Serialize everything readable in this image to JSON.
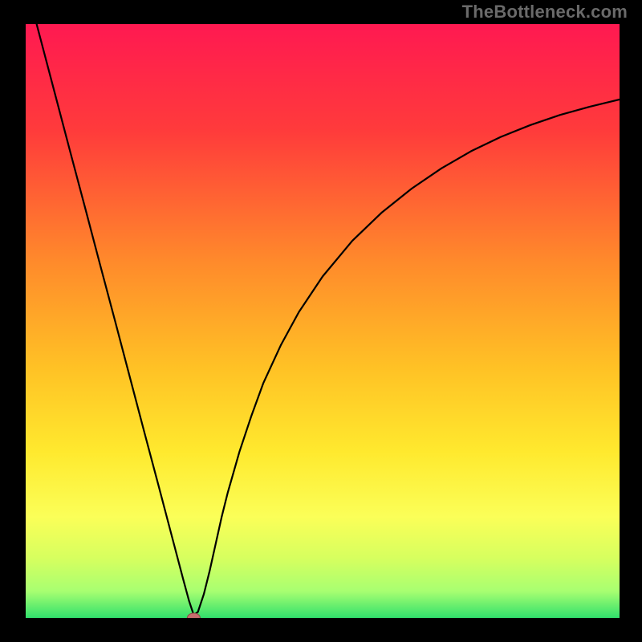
{
  "watermark": {
    "text": "TheBottleneck.com"
  },
  "colors": {
    "border": "#000000",
    "watermark_color": "#6a6a6a",
    "gradient_stops": [
      {
        "offset": 0.0,
        "color": "#ff1951"
      },
      {
        "offset": 0.18,
        "color": "#ff3b3b"
      },
      {
        "offset": 0.4,
        "color": "#ff8a2b"
      },
      {
        "offset": 0.58,
        "color": "#ffc225"
      },
      {
        "offset": 0.72,
        "color": "#ffe92e"
      },
      {
        "offset": 0.83,
        "color": "#fbff58"
      },
      {
        "offset": 0.9,
        "color": "#d6ff5f"
      },
      {
        "offset": 0.955,
        "color": "#a8ff71"
      },
      {
        "offset": 1.0,
        "color": "#31e06c"
      }
    ],
    "curve": "#000000",
    "dot_fill": "#c76e6e",
    "dot_stroke": "#914646"
  },
  "chart_data": {
    "type": "line",
    "title": "",
    "xlabel": "",
    "ylabel": "",
    "xlim": [
      0,
      100
    ],
    "ylim": [
      0,
      100
    ],
    "series": [
      {
        "name": "bottleneck-curve",
        "x": [
          0,
          2.5,
          5,
          7.5,
          10,
          12.5,
          15,
          17.5,
          20,
          22.5,
          25,
          26.5,
          27.5,
          28.3,
          29,
          30,
          31,
          32,
          33,
          34,
          36,
          38,
          40,
          43,
          46,
          50,
          55,
          60,
          65,
          70,
          75,
          80,
          85,
          90,
          95,
          100
        ],
        "y": [
          107,
          97.5,
          88,
          78.5,
          69.1,
          59.6,
          50.2,
          40.7,
          31.2,
          21.8,
          12.3,
          6.6,
          2.9,
          0.5,
          1,
          4,
          8,
          12.5,
          17,
          21,
          28,
          34,
          39.5,
          46,
          51.5,
          57.5,
          63.5,
          68.3,
          72.3,
          75.7,
          78.6,
          81,
          83,
          84.7,
          86.1,
          87.3
        ]
      }
    ],
    "marker": {
      "x": 28.3,
      "y": 0.0
    }
  }
}
